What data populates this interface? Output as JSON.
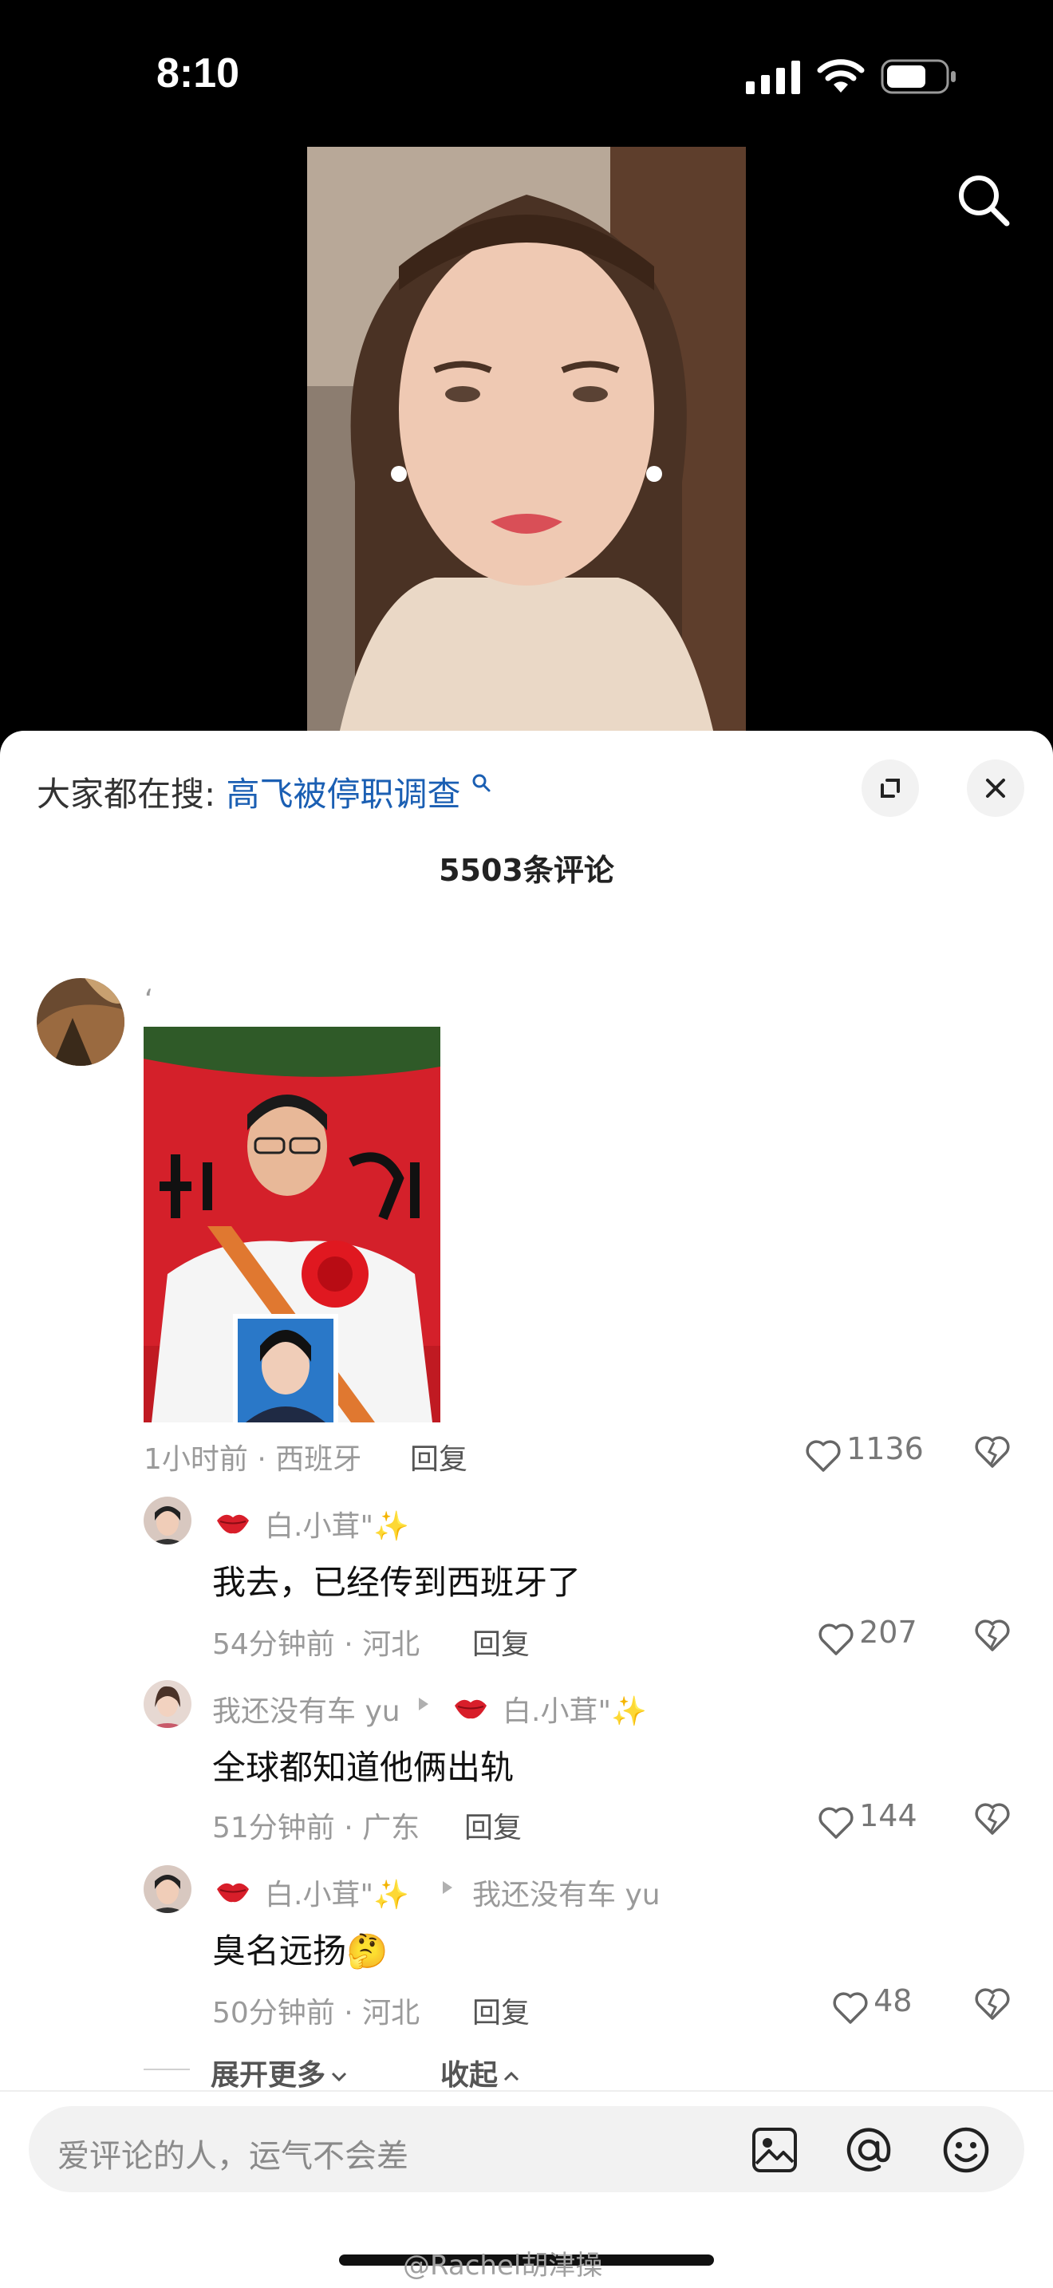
{
  "status_bar": {
    "time": "8:10"
  },
  "header": {
    "search_prefix": "大家都在搜:",
    "search_query": "高飞被停职调查",
    "comment_count": "5503条评论"
  },
  "comments": {
    "main": {
      "username": "،",
      "meta": "1小时前 · 西班牙",
      "reply_label": "回复",
      "likes": "1136"
    },
    "replies": [
      {
        "author": "白.小茸\"✨",
        "reply_to": "",
        "text": "我去，已经传到西班牙了",
        "meta": "54分钟前 · 河北",
        "reply_label": "回复",
        "likes": "207"
      },
      {
        "author": "我还没有车 yu",
        "reply_to": "白.小茸\"✨",
        "text": "全球都知道他俩出轨",
        "meta": "51分钟前 · 广东",
        "reply_label": "回复",
        "likes": "144"
      },
      {
        "author": "白.小茸\"✨",
        "reply_to": "我还没有车 yu",
        "text": "臭名远扬🤔",
        "meta": "50分钟前 · 河北",
        "reply_label": "回复",
        "likes": "48"
      }
    ],
    "expand_more": "展开更多",
    "collapse": "收起"
  },
  "input": {
    "placeholder": "爱评论的人，运气不会差"
  },
  "watermark": "@Rachel胡津操",
  "icons": [
    "signal-icon",
    "wifi-icon",
    "battery-icon",
    "search-icon",
    "expand-icon",
    "close-icon",
    "heart-icon",
    "dislike-icon",
    "image-icon",
    "at-icon",
    "emoji-icon"
  ]
}
